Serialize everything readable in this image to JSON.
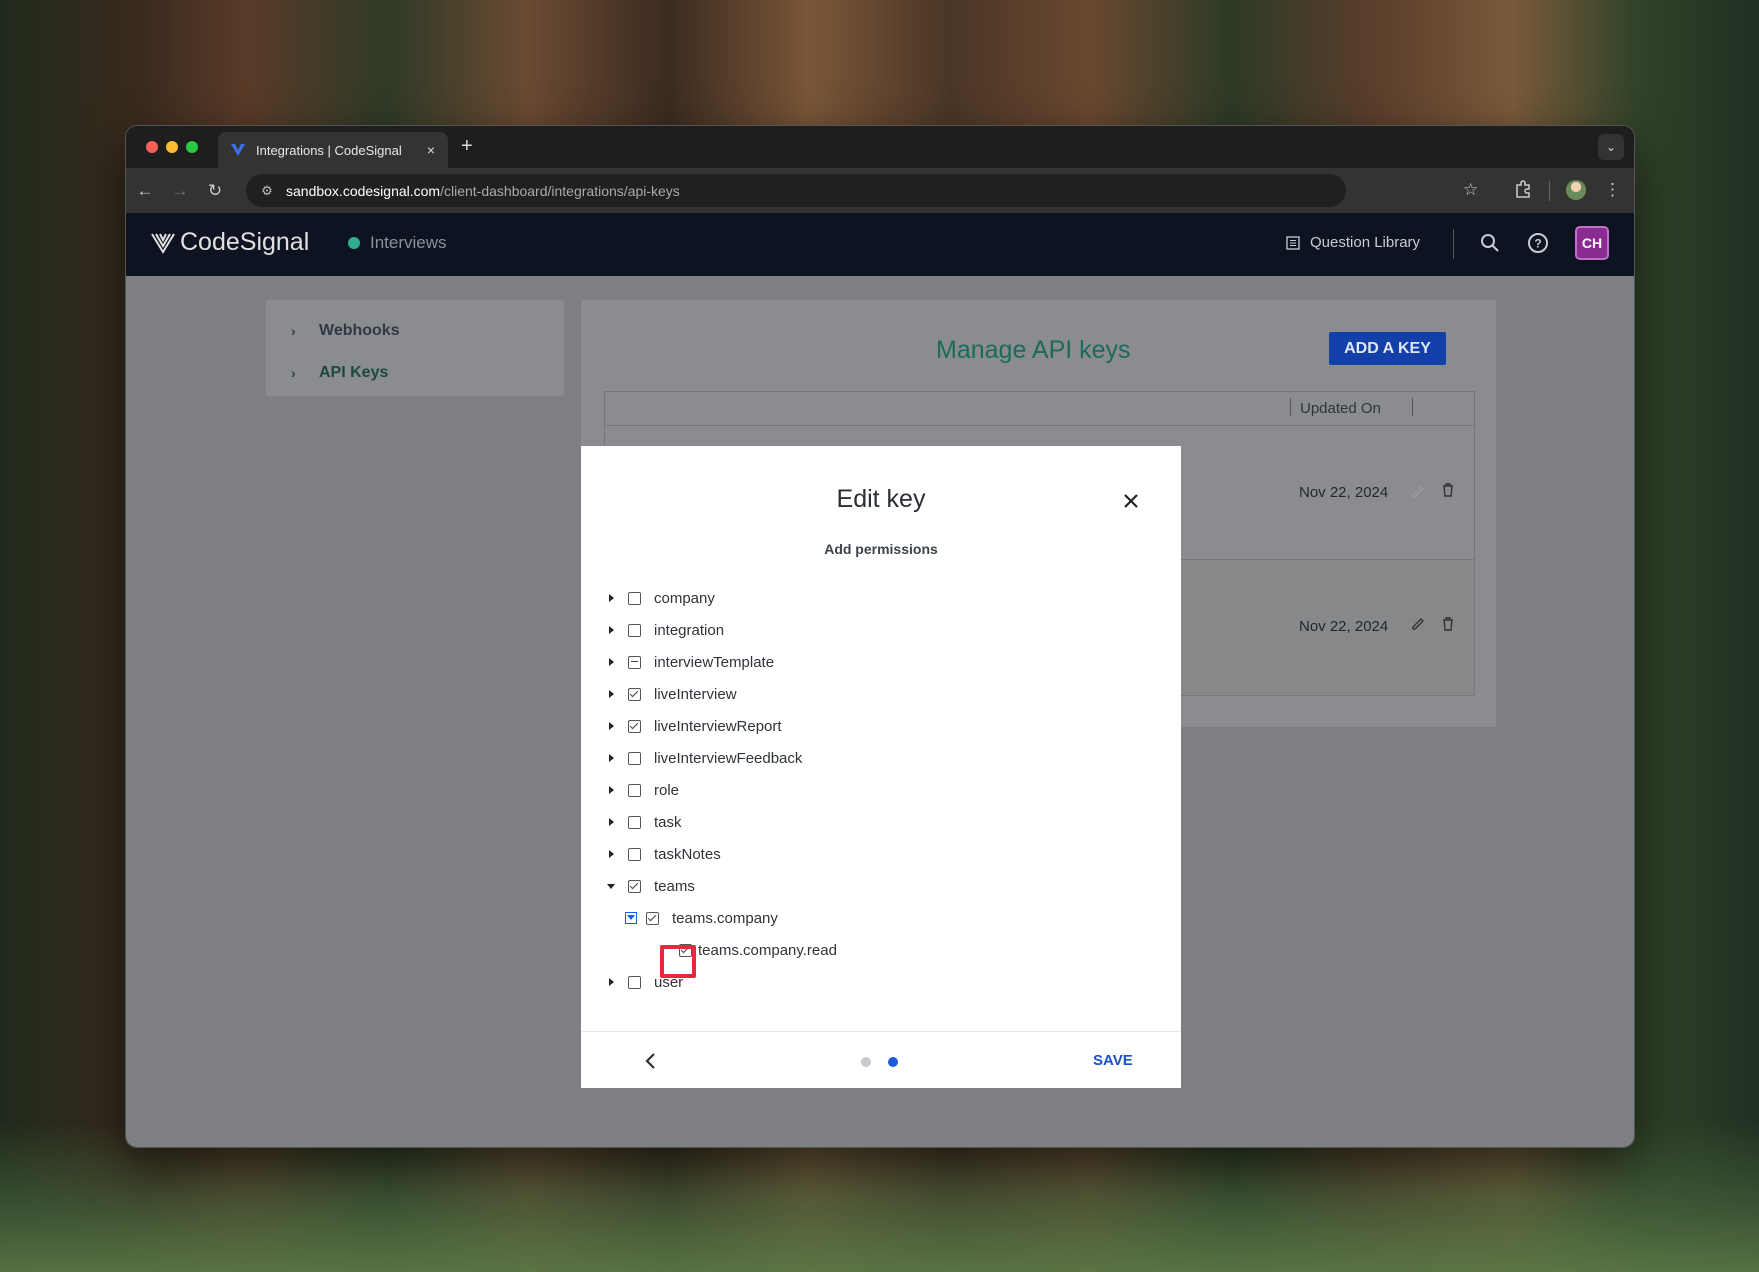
{
  "browser": {
    "tab_title": "Integrations | CodeSignal",
    "tab_close": "×",
    "new_tab": "+",
    "url_host": "sandbox.codesignal.com",
    "url_path": "/client-dashboard/integrations/api-keys"
  },
  "header": {
    "logo_text": "CodeSignal",
    "product": "Interviews",
    "question_library": "Question Library",
    "avatar_initials": "CH"
  },
  "sidebar": {
    "items": [
      {
        "label": "Webhooks"
      },
      {
        "label": "API Keys"
      }
    ]
  },
  "page": {
    "title": "Manage API keys",
    "add_key": "ADD A KEY",
    "column_updated": "Updated On",
    "rows": [
      {
        "updated": "Nov 22, 2024"
      },
      {
        "updated": "Nov 22, 2024"
      }
    ]
  },
  "modal": {
    "title": "Edit key",
    "subtitle": "Add permissions",
    "save": "SAVE",
    "step_current": 2,
    "step_total": 2,
    "permissions": [
      {
        "label": "company",
        "state": "unchecked",
        "expanded": false
      },
      {
        "label": "integration",
        "state": "unchecked",
        "expanded": false
      },
      {
        "label": "interviewTemplate",
        "state": "partial",
        "expanded": false
      },
      {
        "label": "liveInterview",
        "state": "checked",
        "expanded": false
      },
      {
        "label": "liveInterviewReport",
        "state": "checked",
        "expanded": false
      },
      {
        "label": "liveInterviewFeedback",
        "state": "unchecked",
        "expanded": false
      },
      {
        "label": "role",
        "state": "unchecked",
        "expanded": false
      },
      {
        "label": "task",
        "state": "unchecked",
        "expanded": false
      },
      {
        "label": "taskNotes",
        "state": "unchecked",
        "expanded": false
      },
      {
        "label": "teams",
        "state": "checked",
        "expanded": true
      },
      {
        "label": "teams.company",
        "state": "checked",
        "expanded": true
      },
      {
        "label": "teams.company.read",
        "state": "checked",
        "expanded": false
      },
      {
        "label": "user",
        "state": "unchecked",
        "expanded": false
      }
    ]
  },
  "colors": {
    "accent_blue": "#1a4fd0",
    "header_bg": "#0d1320",
    "avatar_bg": "#8a2c8f",
    "highlight": "#e8283c"
  }
}
